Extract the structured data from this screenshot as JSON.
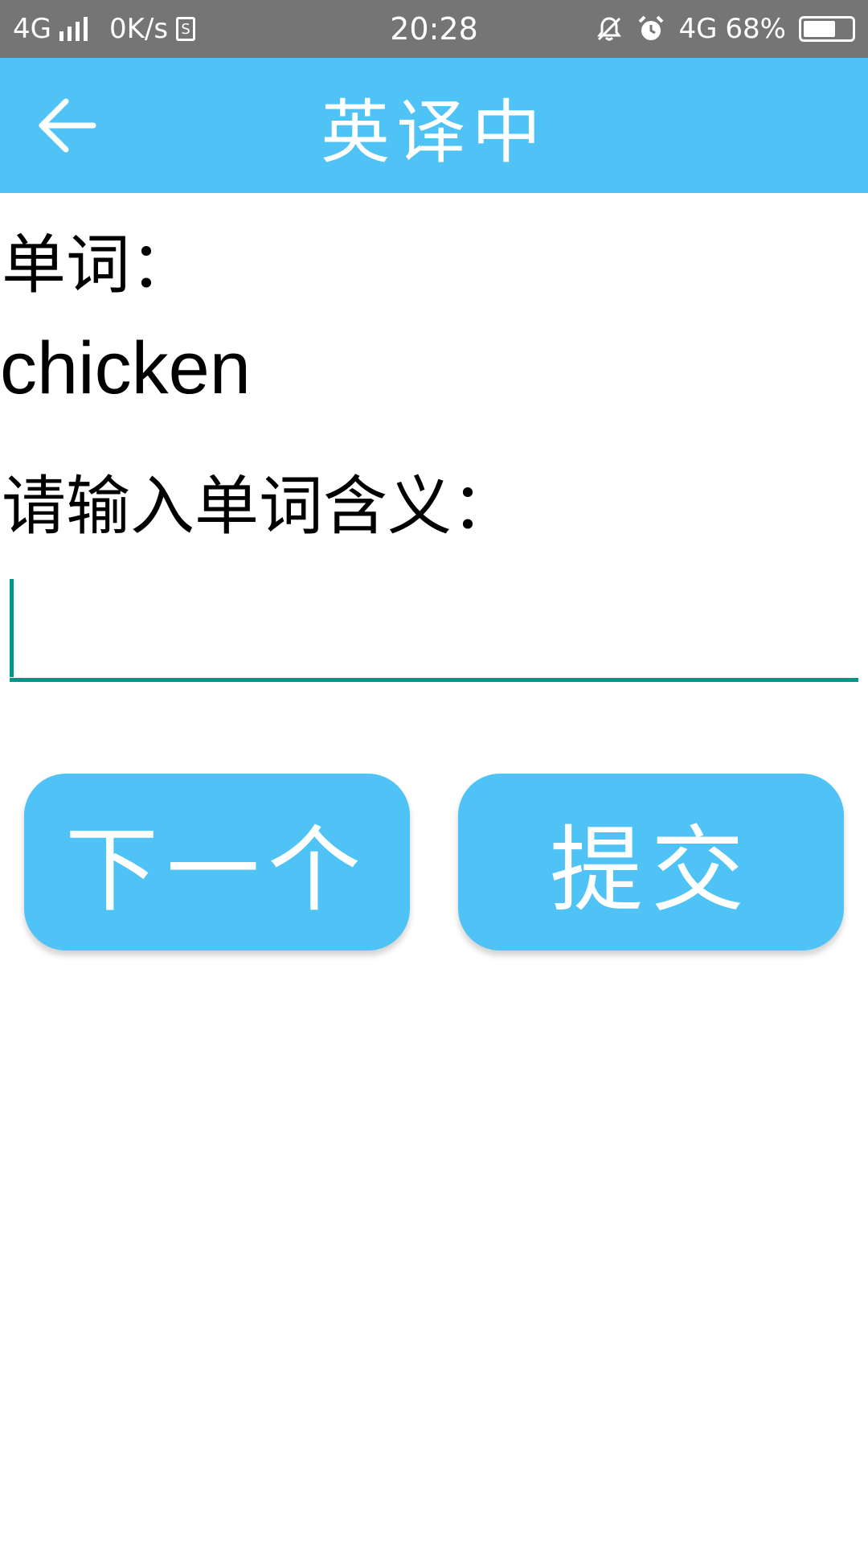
{
  "status_bar": {
    "network_left": "4G",
    "speed": "0K/s",
    "sim_glyph": "S",
    "time": "20:28",
    "network_right": "4G",
    "battery_percent": "68%",
    "battery_level": 0.68,
    "icons": [
      "signal-icon",
      "sim-icon",
      "mute-icon",
      "alarm-icon",
      "battery-icon"
    ]
  },
  "app_bar": {
    "title": "英译中",
    "back_icon": "arrow-left-icon",
    "color": "#4fc3f5"
  },
  "content": {
    "word_label": "单词：",
    "word_value": "chicken",
    "meaning_label": "请输入单词含义：",
    "meaning_input": {
      "value": "",
      "placeholder": ""
    },
    "accent_color": "#009688"
  },
  "buttons": {
    "next_label": "下一个",
    "submit_label": "提交"
  }
}
